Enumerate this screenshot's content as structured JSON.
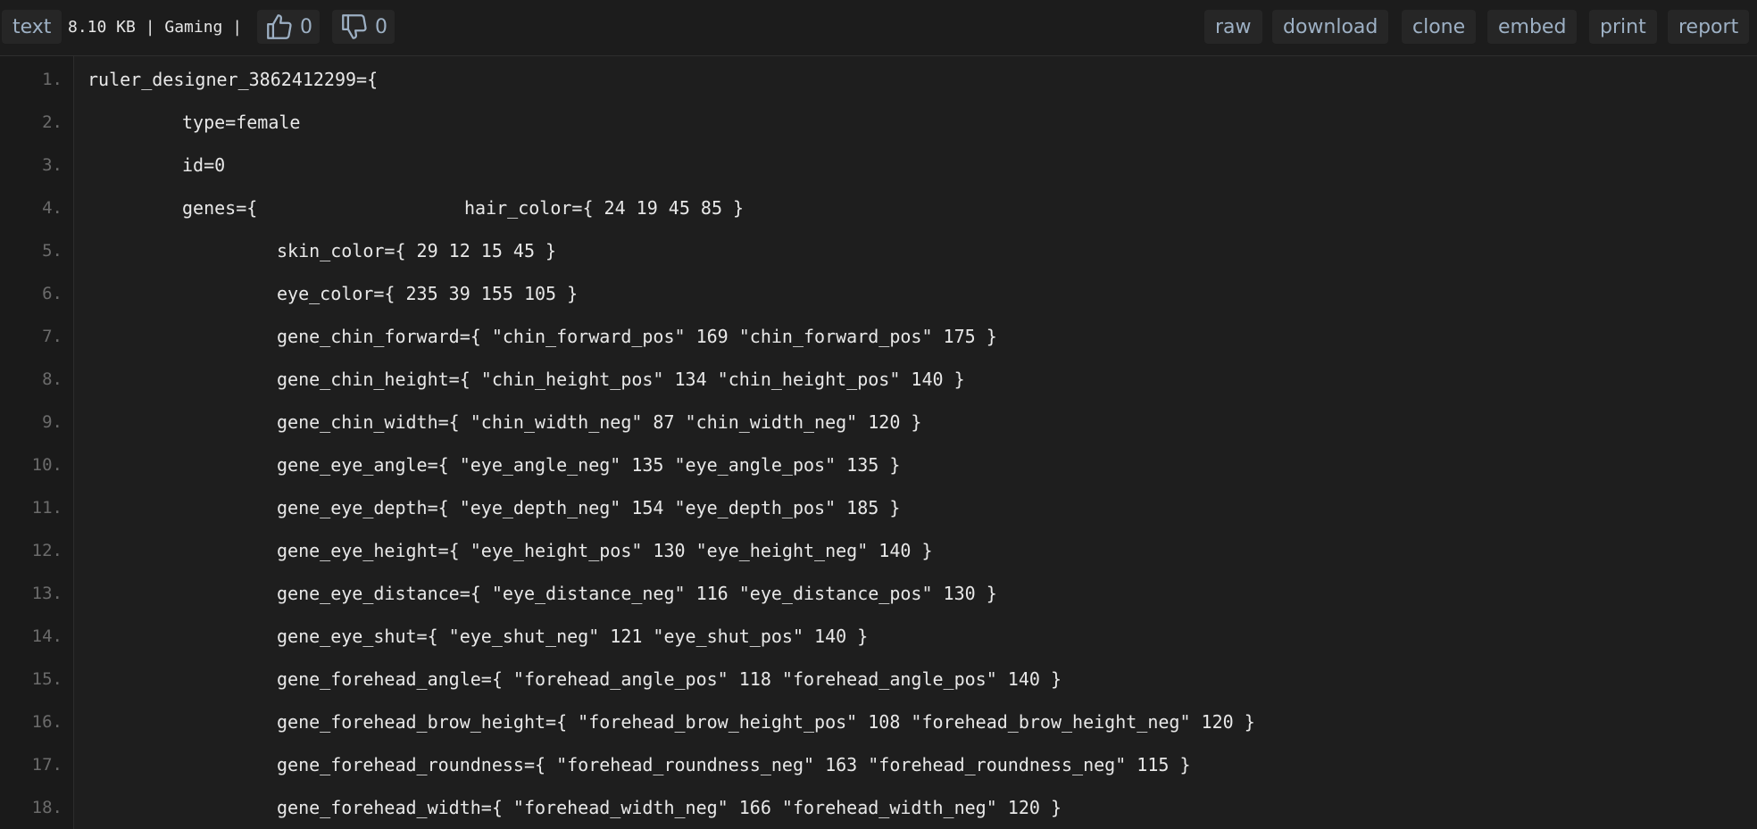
{
  "toolbar": {
    "syntax_label": "text",
    "meta": "8.10 KB | Gaming |",
    "likes": "0",
    "dislikes": "0",
    "actions": [
      "raw",
      "download",
      "clone",
      "embed",
      "print",
      "report"
    ]
  },
  "icons": {
    "like": "thumbs-up-icon",
    "dislike": "thumbs-down-icon"
  },
  "colors": {
    "background": "#1e1e1e",
    "link": "#9db0c4",
    "code_text": "#e8e8e8",
    "line_number": "#6b6b6b"
  },
  "lines": [
    {
      "num": "1.",
      "parts": [
        "ruler_designer_3862412299={"
      ]
    },
    {
      "num": "2.",
      "parts": [
        "type=female"
      ]
    },
    {
      "num": "3.",
      "parts": [
        "id=0"
      ]
    },
    {
      "num": "4.",
      "parts": [
        "genes={",
        "hair_color={ 24 19 45 85 }"
      ]
    },
    {
      "num": "5.",
      "parts": [
        "skin_color={ 29 12 15 45 }"
      ]
    },
    {
      "num": "6.",
      "parts": [
        "eye_color={ 235 39 155 105 }"
      ]
    },
    {
      "num": "7.",
      "parts": [
        "gene_chin_forward={ \"chin_forward_pos\" 169 \"chin_forward_pos\" 175 }"
      ]
    },
    {
      "num": "8.",
      "parts": [
        "gene_chin_height={ \"chin_height_pos\" 134 \"chin_height_pos\" 140 }"
      ]
    },
    {
      "num": "9.",
      "parts": [
        "gene_chin_width={ \"chin_width_neg\" 87 \"chin_width_neg\" 120 }"
      ]
    },
    {
      "num": "10.",
      "parts": [
        "gene_eye_angle={ \"eye_angle_neg\" 135 \"eye_angle_pos\" 135 }"
      ]
    },
    {
      "num": "11.",
      "parts": [
        "gene_eye_depth={ \"eye_depth_neg\" 154 \"eye_depth_pos\" 185 }"
      ]
    },
    {
      "num": "12.",
      "parts": [
        "gene_eye_height={ \"eye_height_pos\" 130 \"eye_height_neg\" 140 }"
      ]
    },
    {
      "num": "13.",
      "parts": [
        "gene_eye_distance={ \"eye_distance_neg\" 116 \"eye_distance_pos\" 130 }"
      ]
    },
    {
      "num": "14.",
      "parts": [
        "gene_eye_shut={ \"eye_shut_neg\" 121 \"eye_shut_pos\" 140 }"
      ]
    },
    {
      "num": "15.",
      "parts": [
        "gene_forehead_angle={ \"forehead_angle_pos\" 118 \"forehead_angle_pos\" 140 }"
      ]
    },
    {
      "num": "16.",
      "parts": [
        "gene_forehead_brow_height={ \"forehead_brow_height_pos\" 108 \"forehead_brow_height_neg\" 120 }"
      ]
    },
    {
      "num": "17.",
      "parts": [
        "gene_forehead_roundness={ \"forehead_roundness_neg\" 163 \"forehead_roundness_neg\" 115 }"
      ]
    },
    {
      "num": "18.",
      "parts": [
        "gene_forehead_width={ \"forehead_width_neg\" 166 \"forehead_width_neg\" 120 }"
      ]
    }
  ]
}
